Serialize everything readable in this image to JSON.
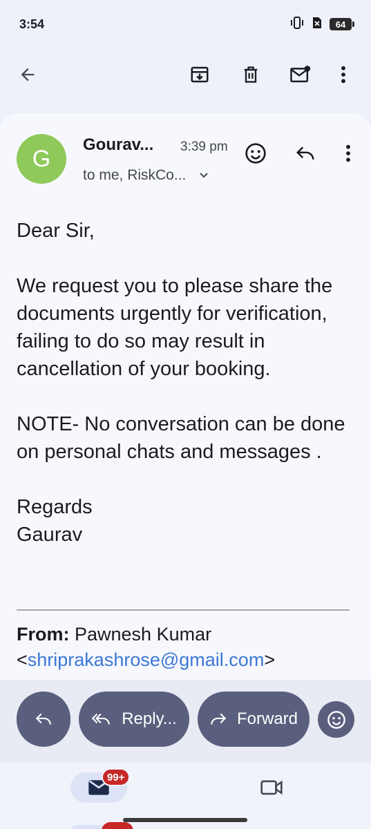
{
  "status_bar": {
    "time": "3:54",
    "battery": "64",
    "icons": [
      "vibrate-icon",
      "no-sim-icon",
      "battery-icon"
    ]
  },
  "toolbar": {
    "icons": [
      "back-arrow-icon",
      "archive-icon",
      "trash-icon",
      "mark-unread-icon",
      "more-vert-icon"
    ]
  },
  "email": {
    "avatar_letter": "G",
    "sender": "Gourav...",
    "time": "3:39 pm",
    "recipients": "to me, RiskCo...",
    "body": [
      "Dear Sir,",
      "We request you to please share the documents urgently for verification, failing to do so may result in cancellation of your booking.",
      "NOTE- No conversation can be done on personal chats and messages .",
      "Regards",
      "Gaurav"
    ],
    "from_label": "From:",
    "from_name": " Pawnesh Kumar",
    "from_open": "<",
    "from_email": "shriprakashrose@gmail.com",
    "from_close": ">"
  },
  "actions": {
    "reply_all_label": "Reply...",
    "forward_label": "Forward"
  },
  "bottom_nav": {
    "mail_badge": "99+"
  },
  "colors": {
    "avatar": "#8fc95a",
    "pill": "#5a5f7e",
    "link": "#3b78d6",
    "badge": "#c62828"
  }
}
